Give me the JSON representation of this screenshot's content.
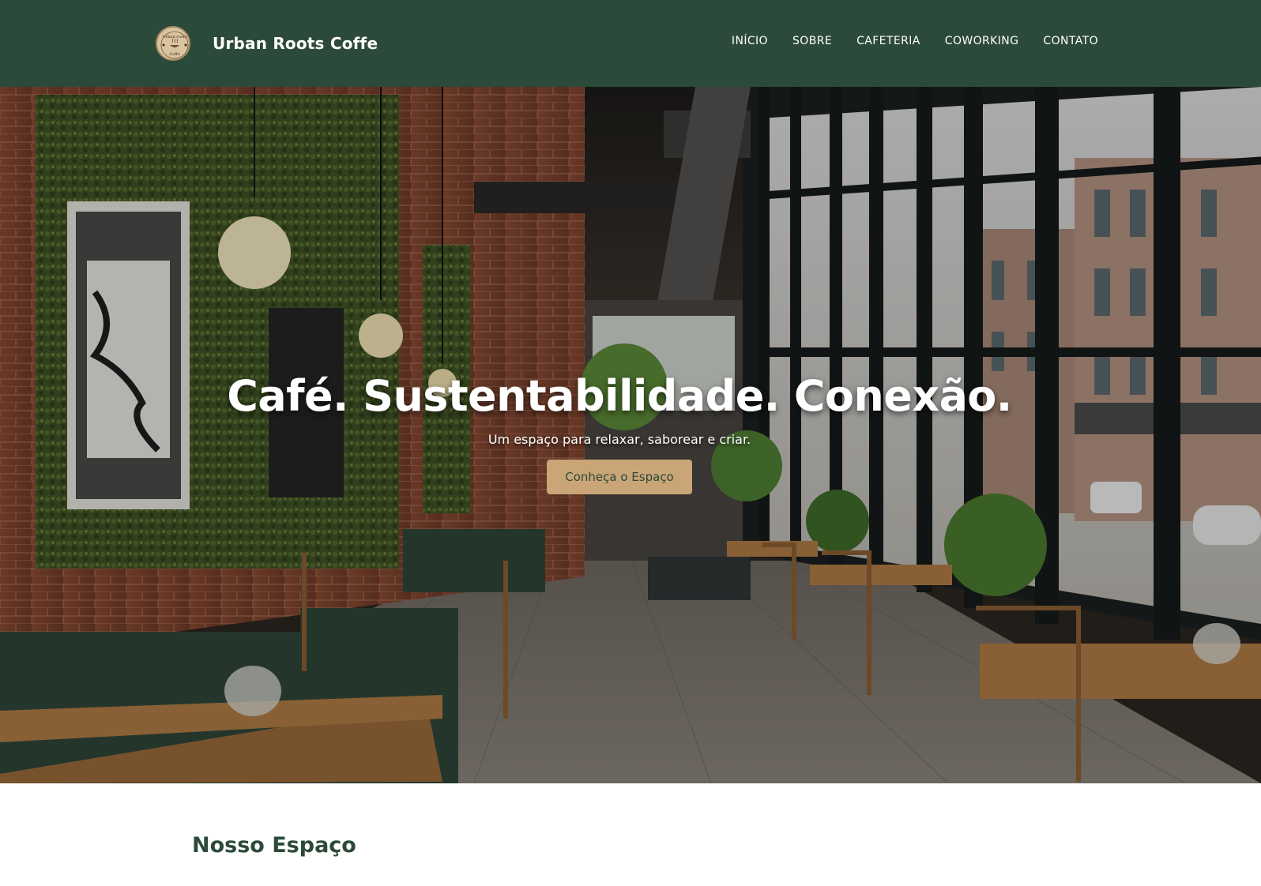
{
  "brand": {
    "name": "Urban Roots Coffe",
    "logo_text_top": "Urban roots",
    "logo_text_bottom": "Coffe"
  },
  "nav": {
    "items": [
      "INÍCIO",
      "SOBRE",
      "CAFETERIA",
      "COWORKING",
      "CONTATO"
    ]
  },
  "hero": {
    "title": "Café. Sustentabilidade. Conexão.",
    "subtitle": "Um espaço para relaxar, saborear e criar.",
    "button_label": "Conheça o Espaço"
  },
  "section": {
    "title": "Nosso Espaço"
  },
  "colors": {
    "primary": "#2c4a39",
    "accent": "#c9a577",
    "text_light": "#ffffff"
  }
}
